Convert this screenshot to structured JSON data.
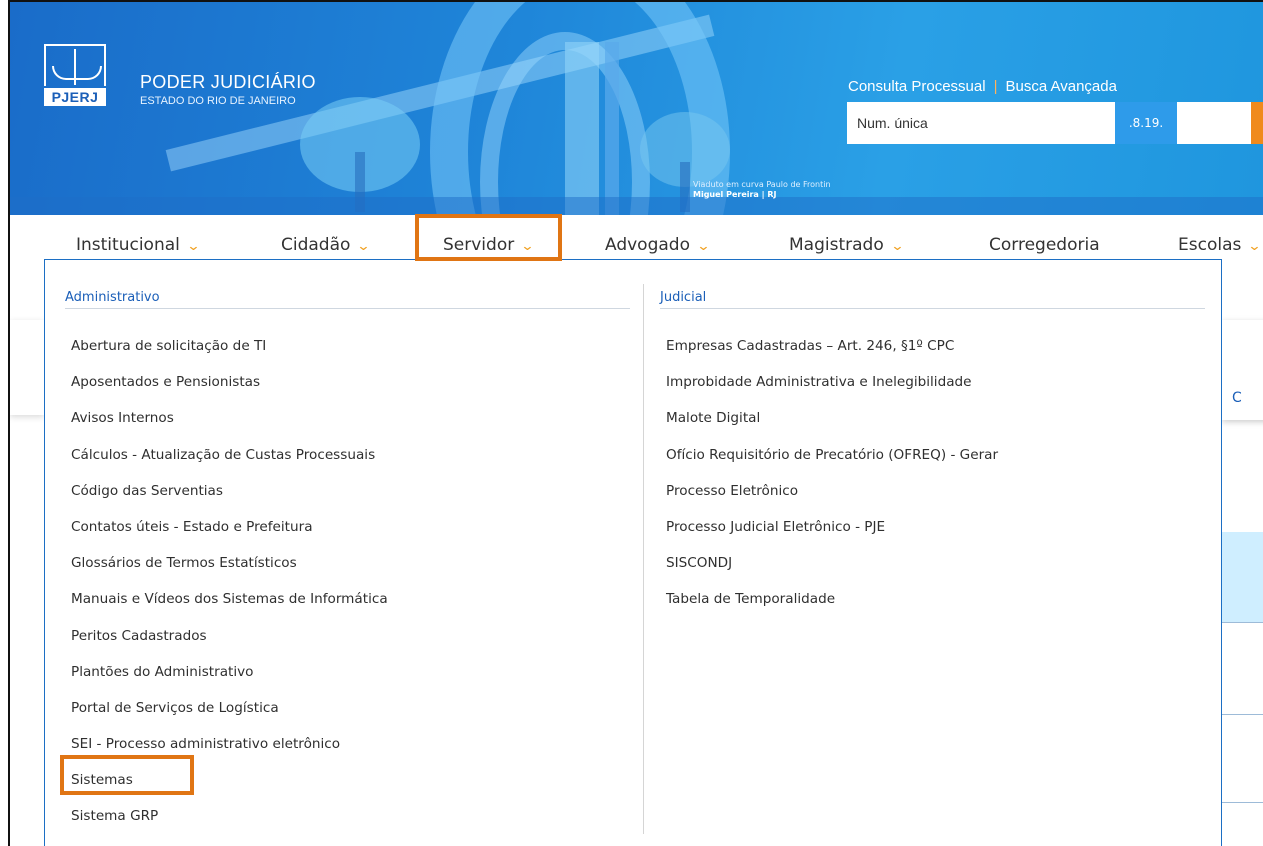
{
  "header": {
    "logo_abbr": "PJERJ",
    "title": "PODER JUDICIÁRIO",
    "subtitle": "ESTADO DO RIO DE JANEIRO",
    "caption_line1": "Viaduto em curva Paulo de Frontin",
    "caption_line2": "Miguel Pereira | RJ",
    "consulta_label": "Consulta Processual",
    "busca_label": "Busca Avançada",
    "search_placeholder": "Num. única",
    "search_code": ".8.19."
  },
  "nav": {
    "items": [
      {
        "label": "Institucional"
      },
      {
        "label": "Cidadão"
      },
      {
        "label": "Servidor"
      },
      {
        "label": "Advogado"
      },
      {
        "label": "Magistrado"
      },
      {
        "label": "Corregedoria"
      },
      {
        "label": "Escolas"
      }
    ],
    "chevron": "⌄"
  },
  "dropdown": {
    "admin_heading": "Administrativo",
    "admin_items": [
      "Abertura de solicitação de TI",
      "Aposentados e Pensionistas",
      "Avisos Internos",
      "Cálculos - Atualização de Custas Processuais",
      "Código das Serventias",
      "Contatos úteis - Estado e Prefeitura",
      "Glossários de Termos Estatísticos",
      "Manuais e Vídeos dos Sistemas de Informática",
      "Peritos Cadastrados",
      "Plantões do Administrativo",
      "Portal de Serviços de Logística",
      "SEI - Processo administrativo eletrônico",
      "Sistemas",
      "Sistema GRP"
    ],
    "judicial_heading": "Judicial",
    "judicial_items": [
      "Empresas Cadastradas – Art. 246, §1º CPC",
      "Improbidade Administrativa e Inelegibilidade",
      "Malote Digital",
      "Ofício Requisitório de Precatório (OFREQ) - Gerar",
      "Processo Eletrônico",
      "Processo Judicial Eletrônico - PJE",
      "SISCONDJ",
      "Tabela de Temporalidade"
    ]
  },
  "background": {
    "panel_letter": "C"
  },
  "colors": {
    "highlight": "#e07514",
    "accent_blue": "#1b5fb8",
    "chevron": "#f0a020"
  }
}
